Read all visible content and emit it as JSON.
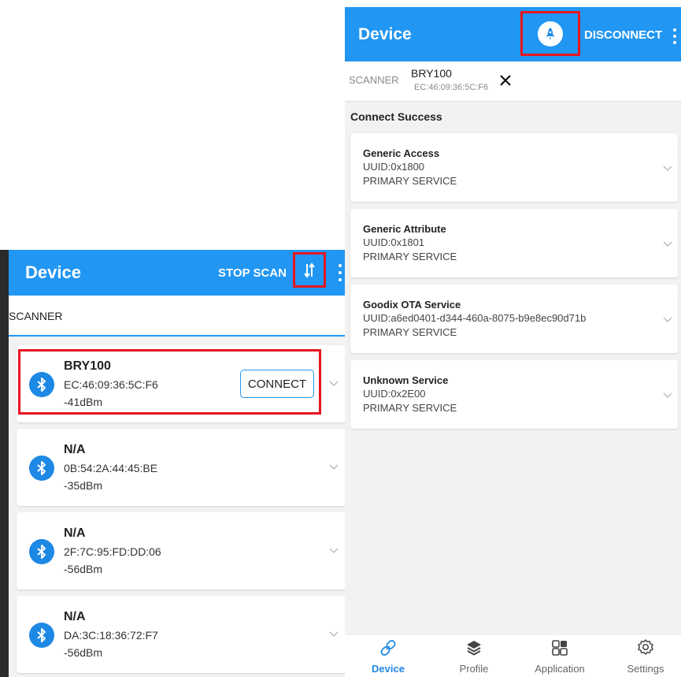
{
  "left_screen": {
    "title": "Device",
    "stop_scan_label": "STOP SCAN",
    "sort_icon": "sort-arrows-icon",
    "scanner_label": "SCANNER",
    "devices": [
      {
        "name": "BRY100",
        "mac": "EC:46:09:36:5C:F6",
        "rssi": "-41dBm",
        "connect_label": "CONNECT"
      },
      {
        "name": "N/A",
        "mac": "0B:54:2A:44:45:BE",
        "rssi": "-35dBm"
      },
      {
        "name": "N/A",
        "mac": "2F:7C:95:FD:DD:06",
        "rssi": "-56dBm"
      },
      {
        "name": "N/A",
        "mac": "DA:3C:18:36:72:F7",
        "rssi": "-56dBm"
      }
    ]
  },
  "right_screen": {
    "title": "Device",
    "disconnect_label": "DISCONNECT",
    "rocket_icon": "rocket-icon",
    "connection": {
      "scanner_label": "SCANNER",
      "device_name": "BRY100",
      "device_mac": "EC:46:09:36:5C:F6"
    },
    "status": "Connect Success",
    "services": [
      {
        "name": "Generic Access",
        "uuid": "UUID:0x1800",
        "type": "PRIMARY SERVICE"
      },
      {
        "name": "Generic Attribute",
        "uuid": "UUID:0x1801",
        "type": "PRIMARY SERVICE"
      },
      {
        "name": "Goodix OTA Service",
        "uuid": "UUID:a6ed0401-d344-460a-8075-b9e8ec90d71b",
        "type": "PRIMARY SERVICE"
      },
      {
        "name": "Unknown Service",
        "uuid": "UUID:0x2E00",
        "type": "PRIMARY SERVICE"
      }
    ],
    "bottom_nav": [
      {
        "label": "Device",
        "icon": "link-icon",
        "active": true
      },
      {
        "label": "Profile",
        "icon": "layers-icon",
        "active": false
      },
      {
        "label": "Application",
        "icon": "apps-grid-icon",
        "active": false
      },
      {
        "label": "Settings",
        "icon": "gear-icon",
        "active": false
      }
    ]
  },
  "colors": {
    "primary": "#2196f3",
    "highlight": "#e5161f",
    "background": "#f2f2f2"
  }
}
